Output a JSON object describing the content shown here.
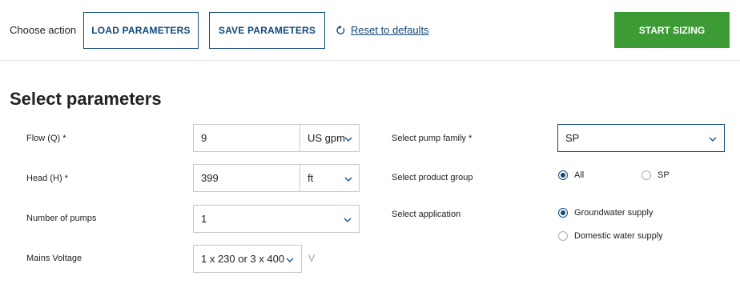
{
  "toolbar": {
    "choose_action_label": "Choose action",
    "load_label": "LOAD PARAMETERS",
    "save_label": "SAVE PARAMETERS",
    "reset_label": "Reset to defaults",
    "start_label": "START SIZING"
  },
  "page": {
    "title": "Select parameters"
  },
  "form": {
    "flow": {
      "label": "Flow (Q) *",
      "value": "9",
      "unit": "US gpm"
    },
    "head": {
      "label": "Head (H) *",
      "value": "399",
      "unit": "ft"
    },
    "pumps": {
      "label": "Number of pumps",
      "value": "1"
    },
    "voltage": {
      "label": "Mains Voltage",
      "value": "1 x 230 or 3 x 400",
      "unit": "V"
    },
    "pump_family": {
      "label": "Select pump family *",
      "value": "SP"
    },
    "product_group": {
      "label": "Select product group",
      "options": [
        "All",
        "SP"
      ],
      "selected": "All"
    },
    "application": {
      "label": "Select application",
      "options": [
        "Groundwater supply",
        "Domestic water supply"
      ],
      "selected": "Groundwater supply"
    }
  },
  "colors": {
    "accent": "#11497b",
    "start_button": "#3d9b35",
    "border": "#c4c8cc"
  },
  "icons": {
    "reset": "refresh-icon",
    "dropdown": "chevron-down-icon"
  }
}
